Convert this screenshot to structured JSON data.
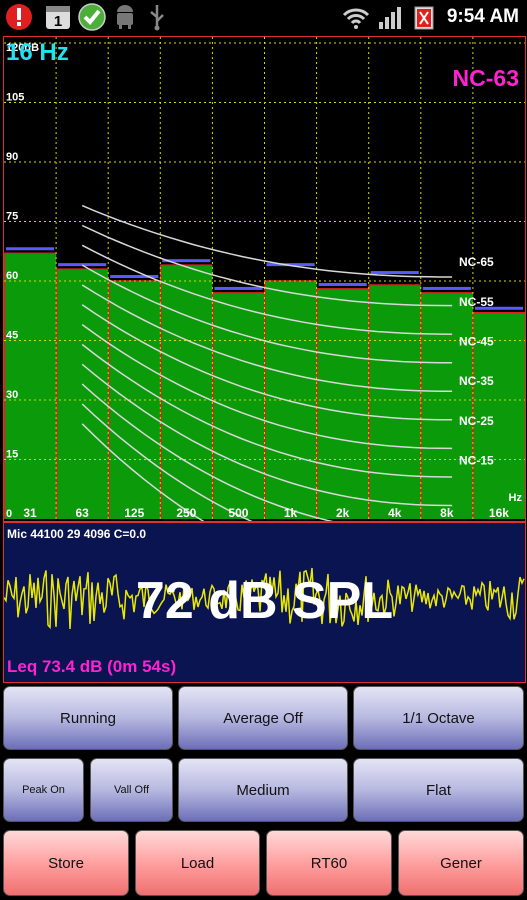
{
  "status_bar": {
    "time": "9:54 AM",
    "calendar_day": "1"
  },
  "spectrum": {
    "frequency_readout": "16 Hz",
    "nc_readout": "NC-63",
    "y_unit": "120dB",
    "y_ticks": [
      "105",
      "90",
      "75",
      "60",
      "45",
      "30",
      "15",
      "0"
    ],
    "x_unit": "Hz",
    "x_ticks": [
      "31",
      "63",
      "125",
      "250",
      "500",
      "1k",
      "2k",
      "4k",
      "8k",
      "16k"
    ],
    "nc_curve_labels": [
      "NC-65",
      "NC-55",
      "NC-45",
      "NC-35",
      "NC-25",
      "NC-15"
    ],
    "chart_data": {
      "type": "bar",
      "categories": [
        "31",
        "63",
        "125",
        "250",
        "500",
        "1k",
        "2k",
        "4k",
        "8k",
        "16k"
      ],
      "ylim": [
        0,
        120
      ],
      "series": [
        {
          "name": "level",
          "values": [
            67,
            63,
            60,
            64,
            57,
            60,
            58,
            59,
            57,
            52
          ]
        },
        {
          "name": "peak",
          "values": [
            68,
            64,
            61,
            65,
            58,
            64,
            59,
            62,
            58,
            53
          ]
        }
      ],
      "nc_curves": [
        {
          "label": "NC-65",
          "values": [
            80,
            75,
            71,
            68,
            66,
            64,
            63,
            62
          ]
        },
        {
          "label": "NC-55",
          "values": [
            76,
            70,
            66,
            62,
            59,
            57,
            56,
            54
          ]
        },
        {
          "label": "NC-45",
          "values": [
            72,
            65,
            59,
            55,
            51,
            49,
            47,
            46
          ]
        },
        {
          "label": "NC-35",
          "values": [
            68,
            60,
            53,
            48,
            44,
            41,
            39,
            37
          ]
        },
        {
          "label": "NC-25",
          "values": [
            64,
            55,
            46,
            40,
            35,
            33,
            31,
            29
          ]
        },
        {
          "label": "NC-15",
          "values": [
            60,
            50,
            40,
            33,
            27,
            24,
            22,
            19
          ]
        }
      ],
      "nc_curve_levels": [
        79,
        74,
        69,
        64,
        59,
        54,
        49,
        44,
        39,
        34,
        29,
        24
      ]
    }
  },
  "waveform": {
    "mic_info": "Mic 44100 29 4096 C=0.0",
    "spl": "72 dB SPL",
    "leq": "Leq  73.4 dB (0m 54s)"
  },
  "buttons": {
    "running": "Running",
    "average": "Average Off",
    "octave": "1/1 Octave",
    "peak": "Peak On",
    "vall": "Vall Off",
    "medium": "Medium",
    "flat": "Flat",
    "store": "Store",
    "load": "Load",
    "rt60": "RT60",
    "gener": "Gener"
  },
  "colors": {
    "bar_fill": "#0a9a0a",
    "peak_marker": "#5a5aff",
    "grid": "#d8d800",
    "nc_curve": "#d8d8d8",
    "accent_cyan": "#26e0f2",
    "accent_magenta": "#ff22d0"
  }
}
